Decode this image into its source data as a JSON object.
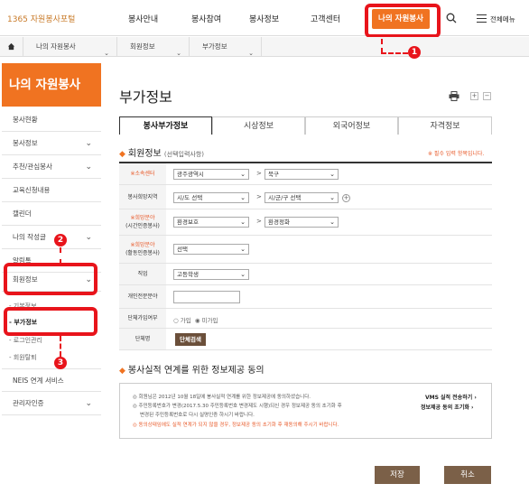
{
  "header": {
    "logo": "1365 자원봉사포털",
    "nav": [
      "봉사안내",
      "봉사참여",
      "봉사정보",
      "고객센터"
    ],
    "active_nav": "나의 자원봉사",
    "all_menu": "전체메뉴"
  },
  "breadcrumb": [
    "나의 자원봉사",
    "회원정보",
    "부가정보"
  ],
  "markers": [
    "1",
    "2",
    "3"
  ],
  "sidebar": {
    "title": "나의 자원봉사",
    "items": [
      "봉사현황",
      "봉사정보",
      "추천/관심봉사",
      "교육신청내용",
      "캘린더",
      "나의 작성글",
      "알림톡",
      "회원정보"
    ],
    "sub_items": [
      "기본정보",
      "부가정보",
      "로그인관리",
      "회원탈퇴"
    ],
    "items_after": [
      "NEIS 연계 서비스",
      "관리자인증"
    ]
  },
  "main": {
    "title": "부가정보",
    "tabs": [
      "봉사부가정보",
      "시상정보",
      "외국어정보",
      "자격정보"
    ],
    "section1": {
      "title": "회원정보",
      "sub": "(선택입력사항)",
      "required_note": "※ 필수 입력 항목입니다."
    },
    "form": {
      "center_label": "※소속센터",
      "center_values": [
        "광주광역시",
        "북구"
      ],
      "region_label": "봉사희망지역",
      "region_values": [
        "시/도 선택",
        "시/군/구 선택"
      ],
      "field1_label": [
        "※희망분야",
        "(시간인증봉사)"
      ],
      "field1_values": [
        "환경보호",
        "환경정화"
      ],
      "field2_label": [
        "※희망분야",
        "(활동인증봉사)"
      ],
      "field2_value": "선택",
      "job_label": "직업",
      "job_value": "고등학생",
      "expertise_label": "개인전문분야",
      "group_label": "단체가입여부",
      "group_options": [
        "가입",
        "미가입"
      ],
      "group_name_label": "단체명",
      "group_search": "단체검색"
    },
    "section2": {
      "title": "봉사실적 연계를 위한 정보제공 동의"
    },
    "notice": {
      "lines": [
        "◎ 회원님은 2012년 10월 18일에 봉사실적 연계를 위한 정보제공에 동의하셨습니다.",
        "◎ 주민등록번호가 변경(2017.5.30 주민등록번호 변경제도 시행)되신 경우 정보제공 동의 초기화 후",
        "변경된 주민등록번호로 다시 실명인증 하시기 바랍니다."
      ],
      "warning": "◎ 동의상태임에도 실적 연계가 되지 않을 경우, 정보제공 동의 초기화 후 재동의해 주시기 바랍니다.",
      "links": [
        "VMS 실적 전송하기 ›",
        "정보제공 동의 초기화 ›"
      ]
    },
    "buttons": {
      "save": "저장",
      "cancel": "취소"
    }
  },
  "colors": {
    "accent": "#f07321",
    "annotation": "#e8141b",
    "button": "#7b6048"
  }
}
